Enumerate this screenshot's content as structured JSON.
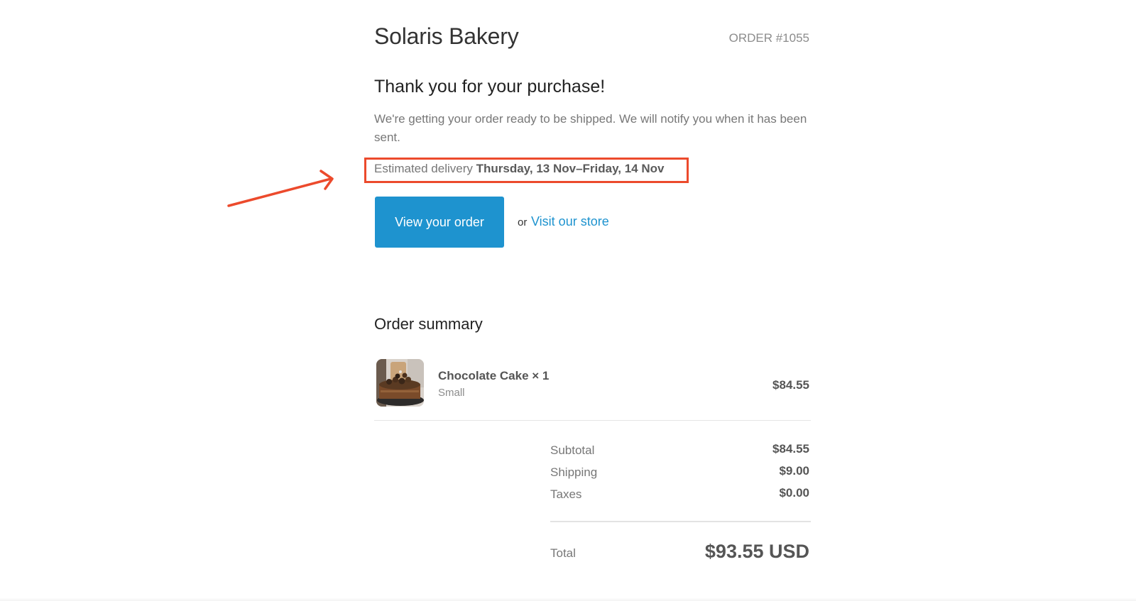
{
  "header": {
    "shop_name": "Solaris Bakery",
    "order_number": "ORDER #1055"
  },
  "message": {
    "title": "Thank you for your purchase!",
    "body": "We're getting your order ready to be shipped. We will notify you when it has been sent.",
    "delivery_label": "Estimated delivery",
    "delivery_dates": "Thursday, 13 Nov–Friday, 14 Nov"
  },
  "actions": {
    "view_order_label": "View your order",
    "or_text": "or",
    "store_link_label": "Visit our store"
  },
  "summary": {
    "title": "Order summary",
    "items": [
      {
        "name": "Chocolate Cake × 1",
        "variant": "Small",
        "price": "$84.55",
        "image_icon": "chocolate-cake-thumbnail"
      }
    ],
    "subtotal_label": "Subtotal",
    "subtotal_value": "$84.55",
    "shipping_label": "Shipping",
    "shipping_value": "$9.00",
    "taxes_label": "Taxes",
    "taxes_value": "$0.00",
    "total_label": "Total",
    "total_value": "$93.55 USD"
  },
  "annotation": {
    "highlight_color": "#ec4a2c"
  },
  "colors": {
    "accent": "#1e93cf",
    "text_dark": "#333333",
    "text_muted": "#777777"
  }
}
